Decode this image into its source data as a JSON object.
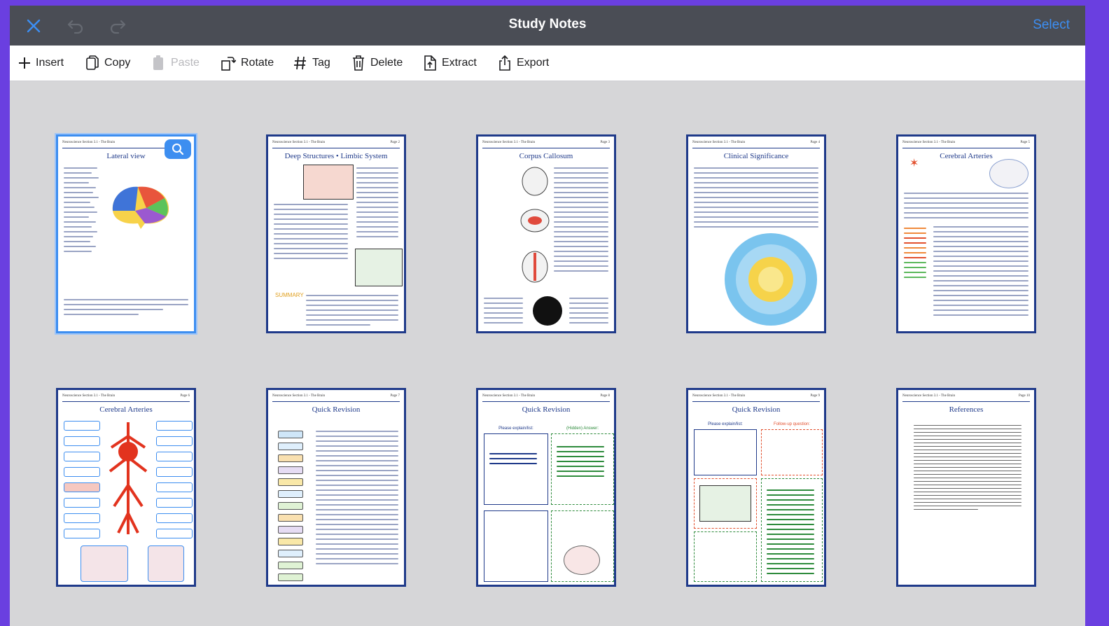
{
  "window": {
    "title": "Study Notes",
    "select_label": "Select",
    "accent": "#3c8ef3",
    "page_border_color": "#1f3a8a"
  },
  "titlebar_icons": [
    "close-icon",
    "undo-icon",
    "redo-icon"
  ],
  "toolbar": {
    "insert": "Insert",
    "copy": "Copy",
    "paste": "Paste",
    "rotate": "Rotate",
    "tag": "Tag",
    "delete": "Delete",
    "extract": "Extract",
    "export": "Export"
  },
  "pages": [
    {
      "header": "Neuroscience Section 3.1 - The Brain",
      "title": "Lateral view",
      "selected": true
    },
    {
      "header": "Neuroscience Section 3.1 - The Brain",
      "page": "Page 2",
      "title": "Deep Structures • Limbic System",
      "note": "SUMMARY"
    },
    {
      "header": "Neuroscience Section 3.1 - The Brain",
      "page": "Page 3",
      "title": "Corpus Callosum"
    },
    {
      "header": "Neuroscience Section 3.1 - The Brain",
      "page": "Page 4",
      "title": "Clinical Significance"
    },
    {
      "header": "Neuroscience Section 3.1 - The Brain",
      "page": "Page 5",
      "title": "Cerebral Arteries"
    },
    {
      "header": "Neuroscience Section 3.1 - The Brain",
      "page": "Page 6",
      "title": "Cerebral Arteries"
    },
    {
      "header": "Neuroscience Section 3.1 - The Brain",
      "page": "Page 7",
      "title": "Quick Revision"
    },
    {
      "header": "Neuroscience Section 3.1 - The Brain",
      "page": "Page 8",
      "title": "Quick Revision",
      "left": "Please explain/list:",
      "right": "(Hidden) Answer:"
    },
    {
      "header": "Neuroscience Section 3.1 - The Brain",
      "page": "Page 9",
      "title": "Quick Revision",
      "left": "Please explain/list:",
      "right": "Follow-up question:"
    },
    {
      "header": "Neuroscience Section 3.1 - The Brain",
      "page": "Page 10",
      "title": "References"
    }
  ]
}
